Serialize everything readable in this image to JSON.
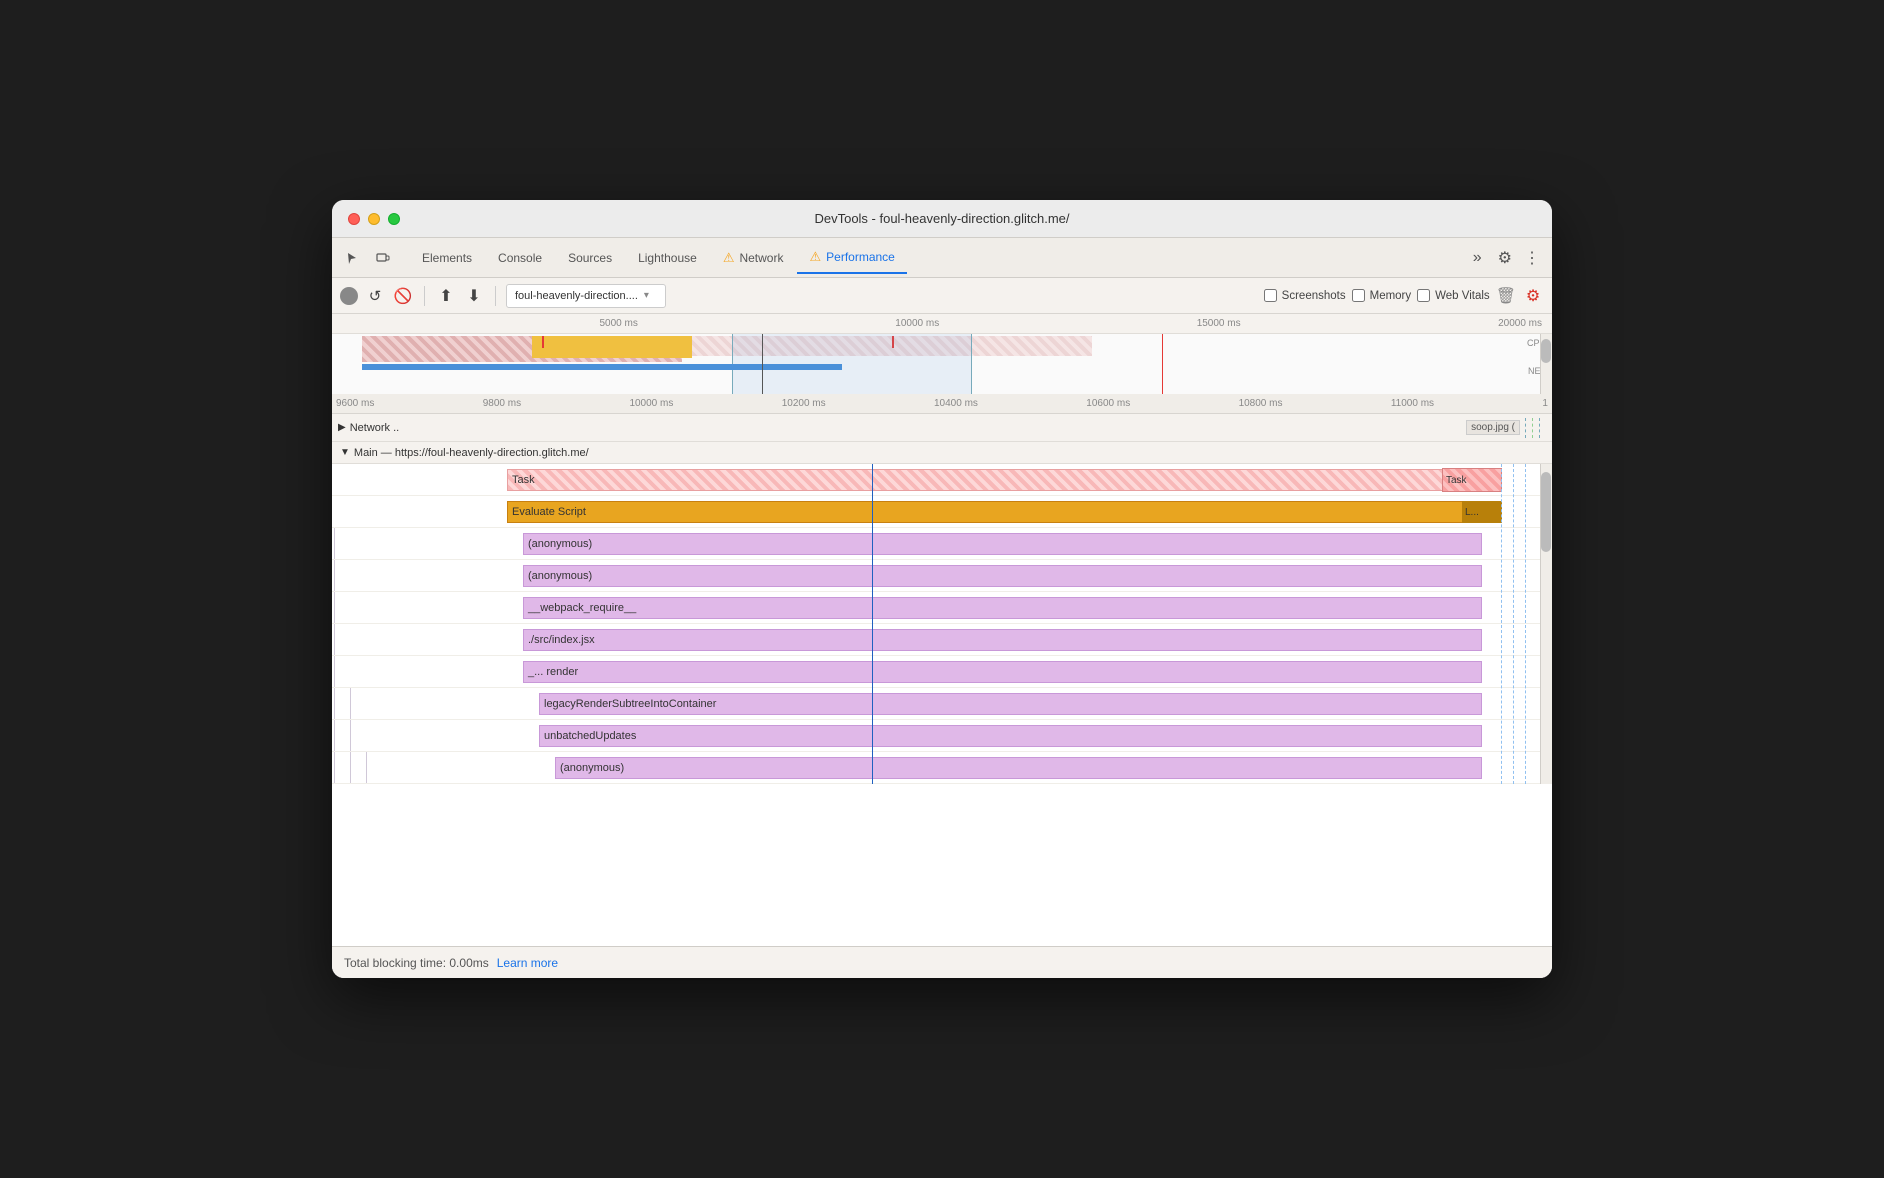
{
  "window": {
    "title": "DevTools - foul-heavenly-direction.glitch.me/"
  },
  "tabs": [
    {
      "id": "elements",
      "label": "Elements",
      "active": false
    },
    {
      "id": "console",
      "label": "Console",
      "active": false
    },
    {
      "id": "sources",
      "label": "Sources",
      "active": false
    },
    {
      "id": "lighthouse",
      "label": "Lighthouse",
      "active": false
    },
    {
      "id": "network",
      "label": "Network",
      "active": false,
      "warn": true
    },
    {
      "id": "performance",
      "label": "Performance",
      "active": true,
      "warn": true
    }
  ],
  "toolbar": {
    "url": "foul-heavenly-direction....",
    "screenshots_label": "Screenshots",
    "memory_label": "Memory",
    "web_vitals_label": "Web Vitals"
  },
  "timeline": {
    "overview_marks": [
      "5000 ms",
      "10000 ms",
      "15000 ms",
      "20000 ms"
    ],
    "detail_marks": [
      "9600 ms",
      "9800 ms",
      "10000 ms",
      "10200 ms",
      "10400 ms",
      "10600 ms",
      "10800 ms",
      "11000 ms",
      "1"
    ]
  },
  "network_row": {
    "label": "Network ..",
    "img_label": "soop.jpg ("
  },
  "main": {
    "header": "Main — https://foul-heavenly-direction.glitch.me/",
    "rows": [
      {
        "id": "task",
        "label": "Task",
        "indent": 0
      },
      {
        "id": "eval",
        "label": "Evaluate Script",
        "indent": 1
      },
      {
        "id": "anon1",
        "label": "(anonymous)",
        "indent": 2
      },
      {
        "id": "anon2",
        "label": "(anonymous)",
        "indent": 2
      },
      {
        "id": "webpack",
        "label": "__webpack_require__",
        "indent": 2
      },
      {
        "id": "src",
        "label": "./src/index.jsx",
        "indent": 2
      },
      {
        "id": "render",
        "label": "_...   render",
        "indent": 2
      },
      {
        "id": "legacy",
        "label": "legacyRenderSubtreeIntoContainer",
        "indent": 3
      },
      {
        "id": "unbatched",
        "label": "unbatchedUpdates",
        "indent": 3
      },
      {
        "id": "anon3",
        "label": "(anonymous)",
        "indent": 3
      }
    ]
  },
  "status_bar": {
    "blocking_time_label": "Total blocking time: 0.00ms",
    "learn_more_label": "Learn more"
  }
}
